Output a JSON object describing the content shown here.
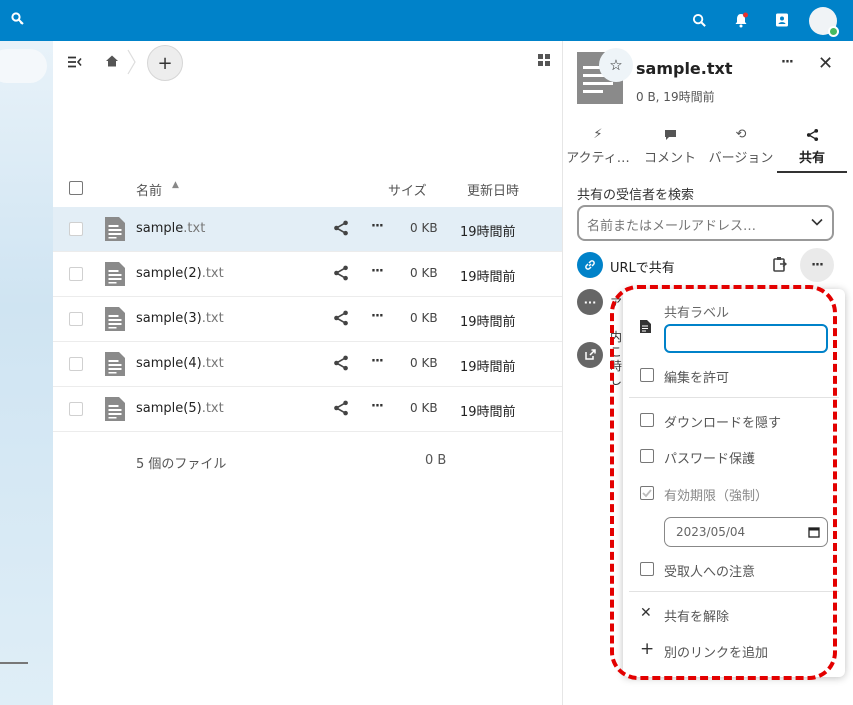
{
  "topbar": {
    "icons": [
      "search-icon",
      "bell-icon",
      "contacts-icon",
      "avatar"
    ]
  },
  "files": {
    "columns": {
      "name": "名前",
      "size": "サイズ",
      "modified": "更新日時"
    },
    "rows": [
      {
        "name": "sample",
        "ext": ".txt",
        "size": "0 KB",
        "modified": "19時間前",
        "selected": true
      },
      {
        "name": "sample(2)",
        "ext": ".txt",
        "size": "0 KB",
        "modified": "19時間前",
        "selected": false
      },
      {
        "name": "sample(3)",
        "ext": ".txt",
        "size": "0 KB",
        "modified": "19時間前",
        "selected": false
      },
      {
        "name": "sample(4)",
        "ext": ".txt",
        "size": "0 KB",
        "modified": "19時間前",
        "selected": false
      },
      {
        "name": "sample(5)",
        "ext": ".txt",
        "size": "0 KB",
        "modified": "19時間前",
        "selected": false
      }
    ],
    "summary": {
      "count": "5 個のファイル",
      "total": "0 B"
    },
    "row_more": "···"
  },
  "sidebar": {
    "title": "sample.txt",
    "subtitle": "0 B, 19時間前",
    "dots": "···",
    "close": "✕",
    "tabs": [
      {
        "label": "アクティ…",
        "icon": "activity-icon"
      },
      {
        "label": "コメント",
        "icon": "comment-icon"
      },
      {
        "label": "バージョン",
        "icon": "history-icon"
      },
      {
        "label": "共有",
        "icon": "share-icon"
      }
    ],
    "search_label": "共有の受信者を検索",
    "search_placeholder": "名前またはメールアドレス…",
    "link_label": "URLで共有",
    "more": "···",
    "peek": [
      "ア",
      "内",
      "こ",
      "時",
      "し"
    ]
  },
  "popup": {
    "share_label_title": "共有ラベル",
    "share_label_value": "",
    "allow_edit": "編集を許可",
    "hide_download": "ダウンロードを隠す",
    "password": "パスワード保護",
    "expiry": "有効期限（強制）",
    "expiry_date": "2023/05/04",
    "note": "受取人への注意",
    "unshare": "共有を解除",
    "add_link": "別のリンクを追加",
    "unshare_icon": "✕",
    "add_icon": "+"
  },
  "colors": {
    "brand": "#0082c9",
    "highlight": "#e30000",
    "selected_row": "#e3eef6"
  }
}
